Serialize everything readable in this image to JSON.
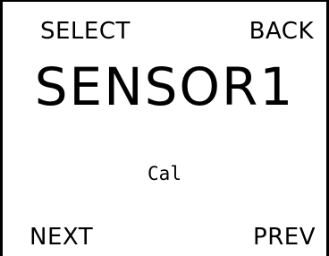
{
  "softkeys": {
    "top_left": "SELECT",
    "top_right": "BACK",
    "bottom_left": "NEXT",
    "bottom_right": "PREV"
  },
  "display": {
    "title": "SENSOR1",
    "subtitle": "Cal"
  }
}
